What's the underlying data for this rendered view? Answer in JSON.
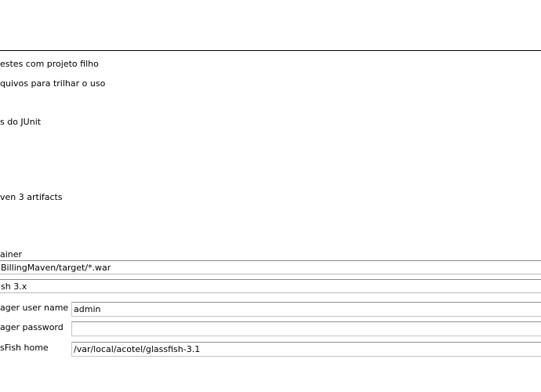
{
  "options": {
    "child_project_tests": "estes com projeto filho",
    "track_usage_files": "quivos para trilhar o uso",
    "junit_reports": "s do JUnit",
    "maven3_artifacts": "ven 3 artifacts"
  },
  "deploy": {
    "container_label": "ainer",
    "war_path_value": "BillingMaven/target/*.war",
    "container_select_value": "sh 3.x",
    "manager_user_label": "ager user name",
    "manager_user_value": "admin",
    "manager_password_label": "ager password",
    "manager_password_value": "",
    "glassfish_home_label": "sFish home",
    "glassfish_home_value": "/var/local/acotel/glassfish-3.1"
  }
}
